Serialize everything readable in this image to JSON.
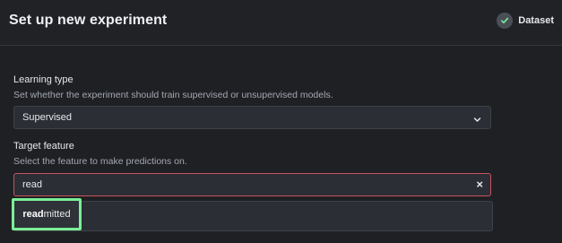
{
  "header": {
    "title": "Set up new experiment",
    "step_label": "Dataset",
    "step_icon": "check-icon"
  },
  "learning_type": {
    "label": "Learning type",
    "help": "Set whether the experiment should train supervised or unsupervised models.",
    "selected": "Supervised"
  },
  "target_feature": {
    "label": "Target feature",
    "help": "Select the feature to make predictions on.",
    "input_value": "read",
    "clear_label": "×",
    "options": [
      {
        "match": "read",
        "rest": "mitted"
      }
    ]
  },
  "colors": {
    "background": "#1e2024",
    "input_error_border": "#c8545c",
    "highlight_border": "#7bee97"
  }
}
